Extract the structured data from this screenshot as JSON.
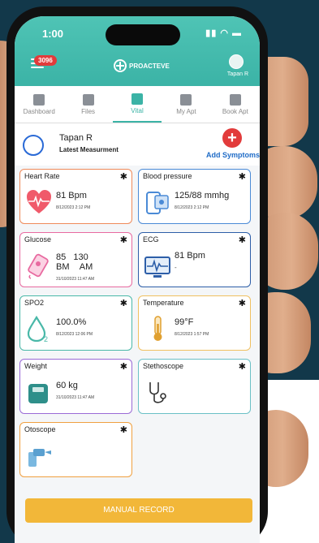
{
  "status": {
    "time": "1:00",
    "icons": "▮▮ ◠ ▬"
  },
  "header": {
    "notification_count": "3096",
    "brand": "PROACTEVE",
    "user_name": "Tapan R"
  },
  "tabs": [
    {
      "label": "Dashboard",
      "icon": "dashboard-icon"
    },
    {
      "label": "Files",
      "icon": "file-icon"
    },
    {
      "label": "Vital",
      "icon": "vital-icon",
      "active": true
    },
    {
      "label": "My Apt",
      "icon": "appointment-icon"
    },
    {
      "label": "Book Apt",
      "icon": "calendar-icon"
    }
  ],
  "user": {
    "name": "Tapan R",
    "subtitle": "Latest Measurment",
    "add_label": "Add Symptoms",
    "add_symbol": "+"
  },
  "cards": [
    {
      "title": "Heart Rate",
      "value": "81 Bpm",
      "date": "8/12/2023  2:12 PM",
      "color": "#ef8a5a",
      "icon": "heart-icon"
    },
    {
      "title": "Blood pressure",
      "value": "125/88 mmhg",
      "date": "8/12/2023  2:12 PM",
      "color": "#4a8ad6",
      "icon": "blood-pressure-icon"
    },
    {
      "title": "Glucose",
      "value1": "85",
      "label1": "BM",
      "value2": "130",
      "label2": "AM",
      "date": "31/10/2023 11:47 AM",
      "color": "#e86aa0",
      "icon": "glucose-meter-icon"
    },
    {
      "title": "ECG",
      "value": "81 Bpm",
      "sub": "-",
      "color": "#2d5ea8",
      "icon": "ecg-icon"
    },
    {
      "title": "SPO2",
      "value": "100.0%",
      "date": "8/12/2023  12:06 PM",
      "color": "#49b8a8",
      "icon": "oxygen-drop-icon"
    },
    {
      "title": "Temperature",
      "value": "99°F",
      "date": "8/12/2023  1:57 PM",
      "color": "#f0c060",
      "icon": "thermometer-icon"
    },
    {
      "title": "Weight",
      "value": "60 kg",
      "date": "31/10/2023 11:47 AM",
      "color": "#9a6ad6",
      "icon": "weighing-scale-icon"
    },
    {
      "title": "Stethoscope",
      "color": "#6ac0c6",
      "icon": "stethoscope-icon"
    },
    {
      "title": "Otoscope",
      "color": "#f0a040",
      "icon": "otoscope-icon"
    }
  ],
  "manual_record": "MANUAL RECORD",
  "gear_symbol": "✱"
}
